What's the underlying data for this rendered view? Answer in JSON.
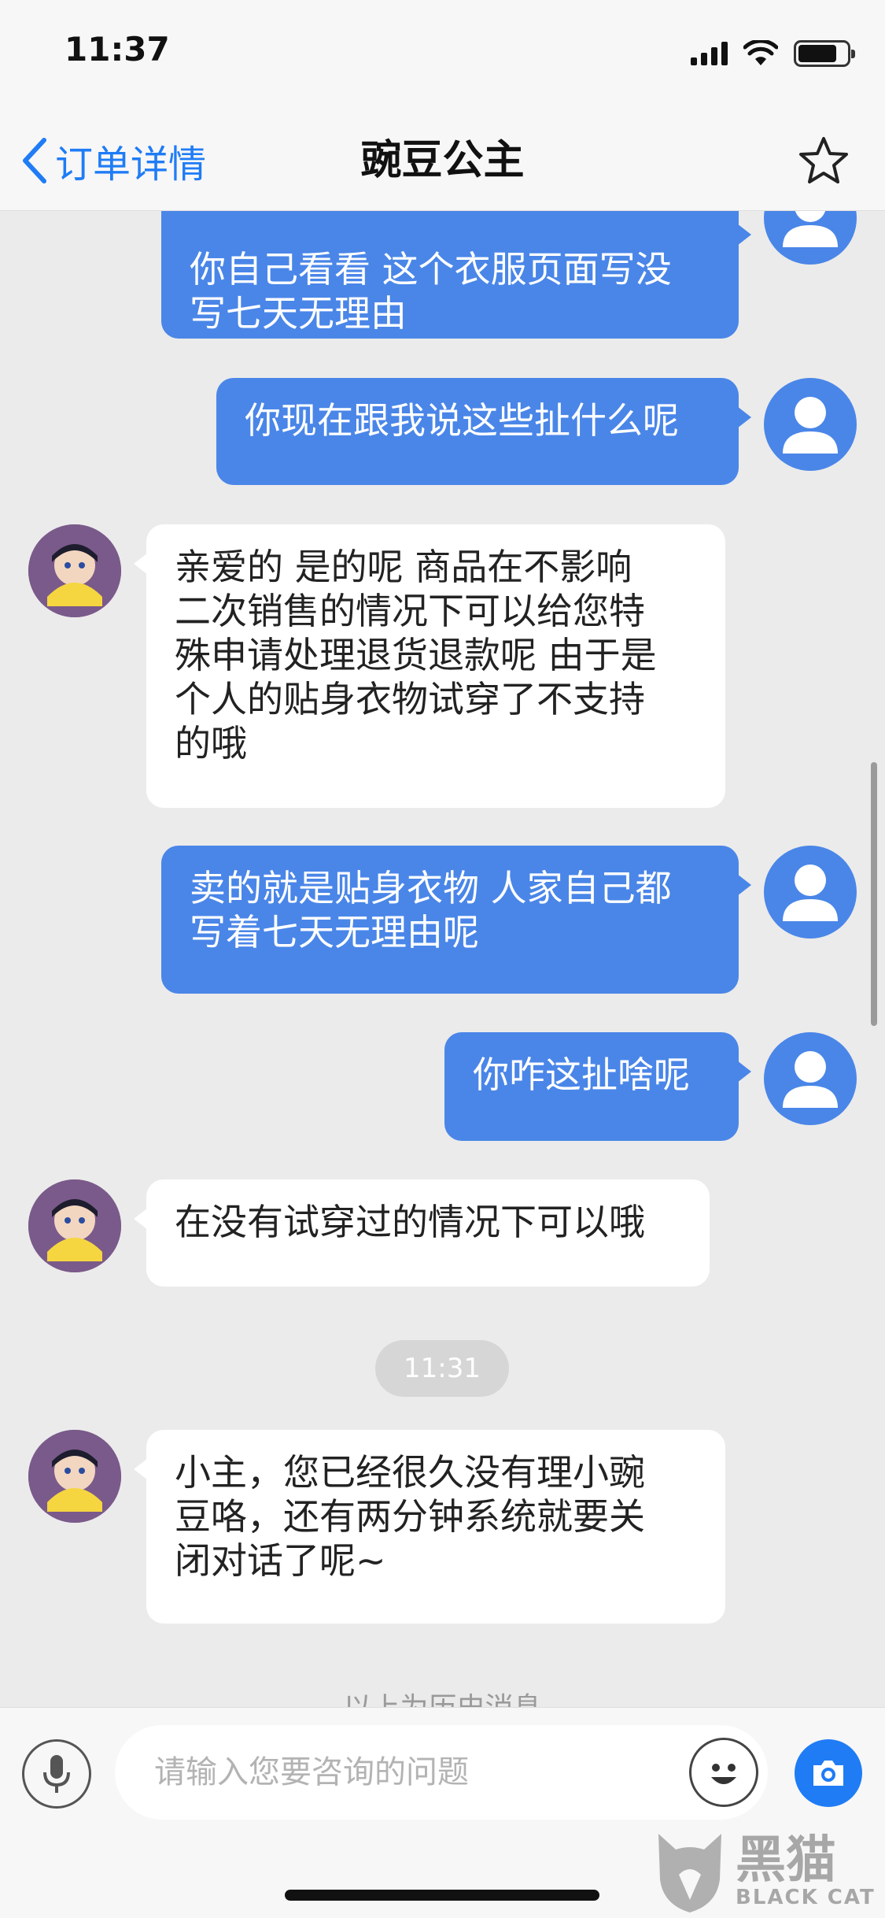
{
  "status_bar": {
    "time": "11:37"
  },
  "nav": {
    "back_label": "订单详情",
    "title": "豌豆公主"
  },
  "messages": [
    {
      "side": "out",
      "lines": [
        "你自己看看 这个衣服页面写没",
        "写七天无理由"
      ]
    },
    {
      "side": "out",
      "lines": [
        "你现在跟我说这些扯什么呢"
      ]
    },
    {
      "side": "in",
      "lines": [
        "亲爱的  是的呢  商品在不影响",
        "二次销售的情况下可以给您特",
        "殊申请处理退货退款呢  由于是",
        "个人的贴身衣物试穿了不支持",
        "的哦"
      ]
    },
    {
      "side": "out",
      "lines": [
        "卖的就是贴身衣物 人家自己都",
        "写着七天无理由呢"
      ]
    },
    {
      "side": "out",
      "lines": [
        "你咋这扯啥呢"
      ]
    },
    {
      "side": "in",
      "lines": [
        "在没有试穿过的情况下可以哦"
      ]
    },
    {
      "side": "in",
      "lines": [
        "小主，您已经很久没有理小豌",
        "豆咯，还有两分钟系统就要关",
        "闭对话了呢~"
      ]
    }
  ],
  "timestamp_chip": "11:31",
  "history_note": "以上为历史消息",
  "input": {
    "placeholder": "请输入您要咨询的问题"
  },
  "watermark": {
    "cn": "黑猫",
    "en": "BLACK CAT"
  },
  "colors": {
    "accent": "#1f7cf5",
    "bubble_out": "#4a86e8",
    "chat_bg": "#ebebeb"
  }
}
